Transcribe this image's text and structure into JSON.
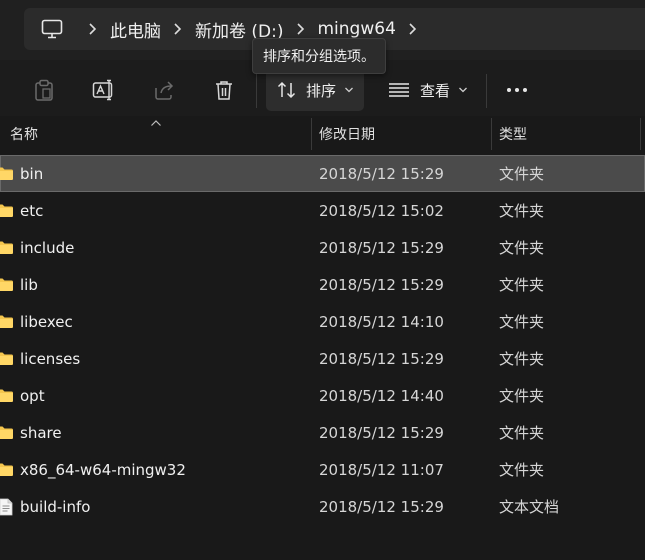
{
  "breadcrumb": {
    "items": [
      {
        "label": "此电脑"
      },
      {
        "label": "新加卷 (D:)"
      },
      {
        "label": "mingw64"
      }
    ]
  },
  "tooltip": {
    "text": "排序和分组选项。"
  },
  "toolbar": {
    "sort_label": "排序",
    "view_label": "查看"
  },
  "columns": {
    "name": "名称",
    "date": "修改日期",
    "type": "类型"
  },
  "rows": [
    {
      "name": "bin",
      "date": "2018/5/12 15:29",
      "type": "文件夹",
      "icon": "folder-icon",
      "selected": true
    },
    {
      "name": "etc",
      "date": "2018/5/12 15:02",
      "type": "文件夹",
      "icon": "folder-icon"
    },
    {
      "name": "include",
      "date": "2018/5/12 15:29",
      "type": "文件夹",
      "icon": "folder-icon"
    },
    {
      "name": "lib",
      "date": "2018/5/12 15:29",
      "type": "文件夹",
      "icon": "folder-icon"
    },
    {
      "name": "libexec",
      "date": "2018/5/12 14:10",
      "type": "文件夹",
      "icon": "folder-icon"
    },
    {
      "name": "licenses",
      "date": "2018/5/12 15:29",
      "type": "文件夹",
      "icon": "folder-icon"
    },
    {
      "name": "opt",
      "date": "2018/5/12 14:40",
      "type": "文件夹",
      "icon": "folder-icon"
    },
    {
      "name": "share",
      "date": "2018/5/12 15:29",
      "type": "文件夹",
      "icon": "folder-icon"
    },
    {
      "name": "x86_64-w64-mingw32",
      "date": "2018/5/12 11:07",
      "type": "文件夹",
      "icon": "folder-icon"
    },
    {
      "name": "build-info",
      "date": "2018/5/12 15:29",
      "type": "文本文档",
      "icon": "text-file-icon"
    }
  ],
  "colors": {
    "folder": "#f4c64e",
    "selected_row": "#4b4b4b",
    "background": "#191919"
  }
}
